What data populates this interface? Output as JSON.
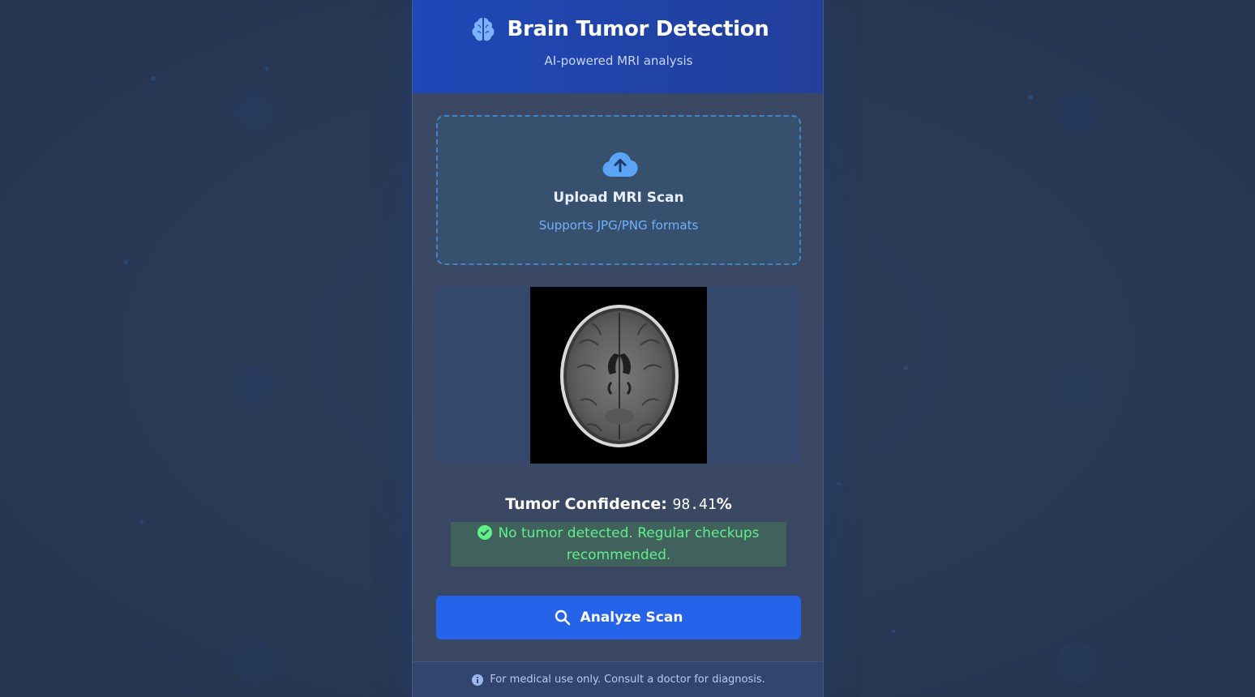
{
  "header": {
    "icon": "brain-icon",
    "title": "Brain Tumor Detection",
    "subtitle": "AI-powered MRI analysis"
  },
  "upload": {
    "icon": "cloud-upload-icon",
    "title": "Upload MRI Scan",
    "subtitle": "Supports JPG/PNG formats"
  },
  "preview": {
    "image": "brain-mri-axial-scan"
  },
  "result": {
    "confidence_label": "Tumor Confidence:",
    "confidence_value": "98.41",
    "confidence_unit": "%",
    "status_icon": "check-circle-icon",
    "status_text": "No tumor detected. Regular checkups recommended."
  },
  "actions": {
    "analyze_icon": "search-icon",
    "analyze_label": "Analyze Scan"
  },
  "footer": {
    "icon": "info-icon",
    "text": "For medical use only. Consult a doctor for diagnosis."
  },
  "colors": {
    "header": "#1f48b8",
    "accent": "#2563eb",
    "success": "#5ff08a",
    "upload_border": "#3f86c9"
  }
}
